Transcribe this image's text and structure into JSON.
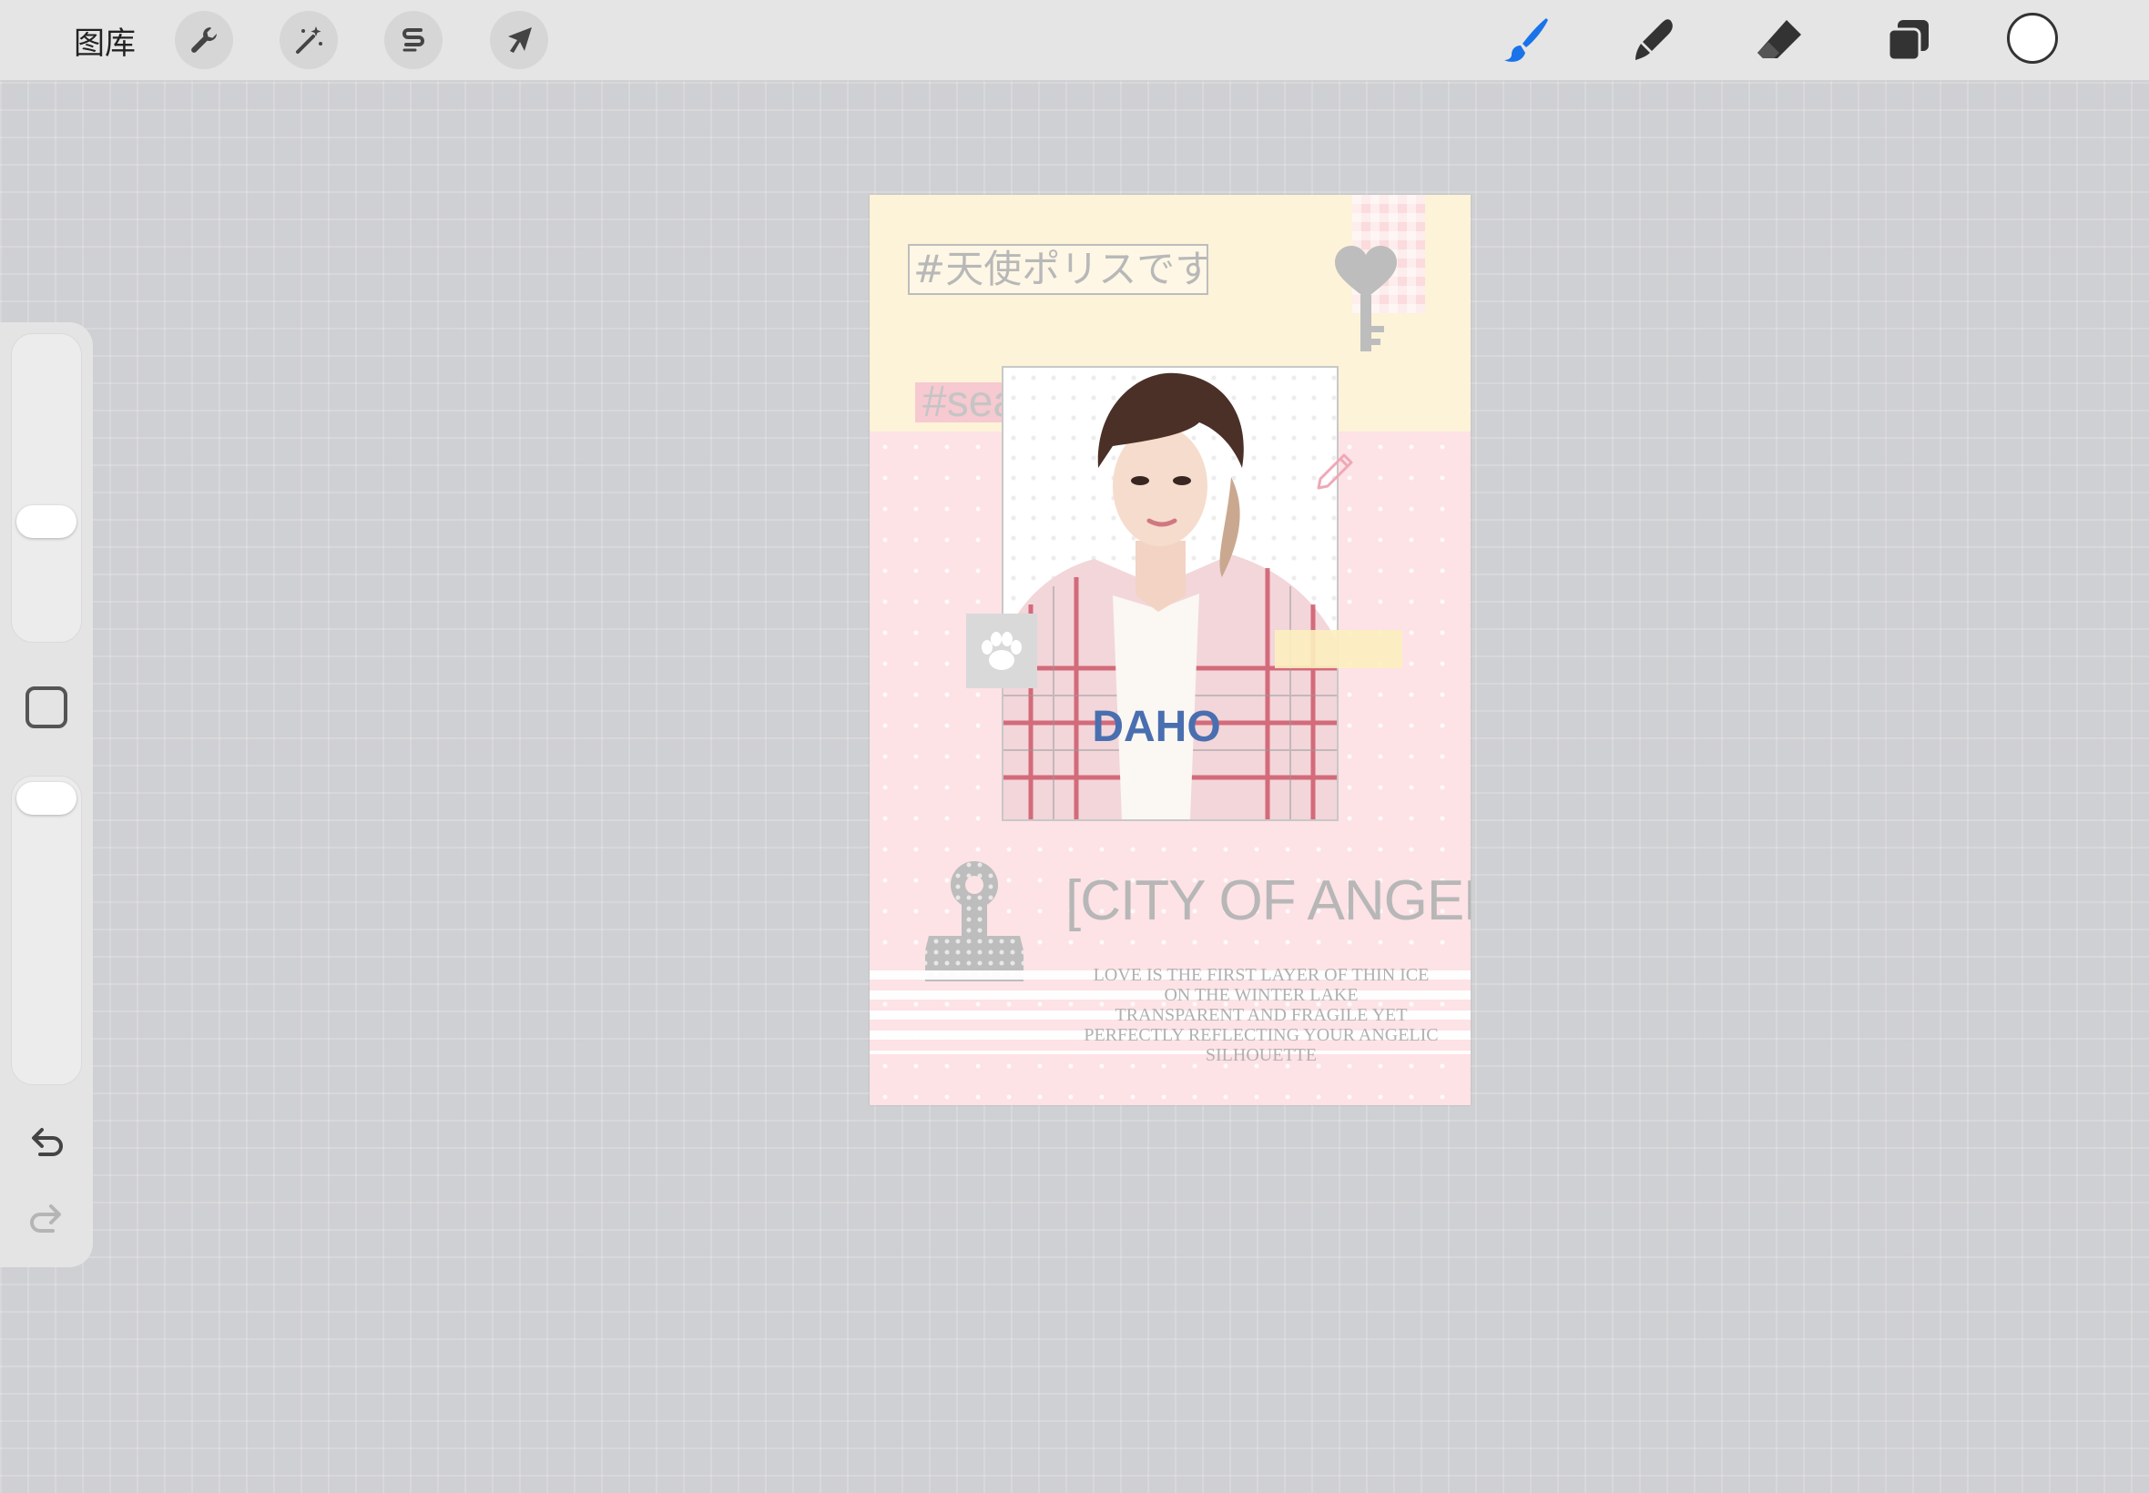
{
  "toolbar": {
    "gallery_label": "图库",
    "left_tools": [
      {
        "name": "actions",
        "icon": "wrench-icon"
      },
      {
        "name": "adjustments",
        "icon": "magic-wand-icon"
      },
      {
        "name": "selection",
        "icon": "selection-s-icon"
      },
      {
        "name": "transform",
        "icon": "arrow-cursor-icon"
      }
    ],
    "right_tools": [
      {
        "name": "paint",
        "icon": "brush-icon",
        "active": true
      },
      {
        "name": "smudge",
        "icon": "smudge-icon",
        "active": false
      },
      {
        "name": "erase",
        "icon": "eraser-icon",
        "active": false
      },
      {
        "name": "layers",
        "icon": "layers-icon",
        "active": false
      }
    ],
    "current_color": "#ffffff",
    "active_color": "#1a73e8"
  },
  "sidebar": {
    "brush_size_level": 0.6,
    "opacity_level": 0.93,
    "icons": [
      "square-modify-icon",
      "undo-icon",
      "redo-icon"
    ]
  },
  "artwork": {
    "tag_japanese": "#天使ポリスです",
    "tag_name": "#sean",
    "title": "[CITY OF ANGELS]",
    "poem_lines": [
      "LOVE IS THE FIRST LAYER OF THIN ICE",
      "ON THE WINTER LAKE",
      "TRANSPARENT AND FRAGILE YET",
      "PERFECTLY REFLECTING YOUR ANGELIC",
      "SILHOUETTE"
    ],
    "colors": {
      "pink": "#fde2e6",
      "cream": "#fdf3d8",
      "gray_text": "#b7b7b7"
    }
  }
}
